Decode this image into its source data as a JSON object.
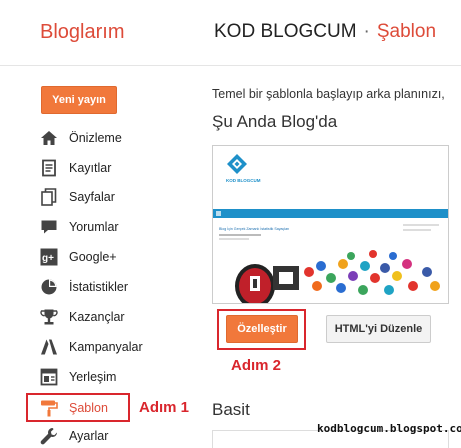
{
  "header": {
    "brand": "Bloglarım",
    "blog_name": "KOD BLOGCUM",
    "separator": "·",
    "page_name": "Şablon"
  },
  "sidebar": {
    "new_post_label": "Yeni yayın",
    "items": [
      {
        "label": "Önizleme",
        "icon": "home-icon"
      },
      {
        "label": "Kayıtlar",
        "icon": "posts-icon"
      },
      {
        "label": "Sayfalar",
        "icon": "pages-icon"
      },
      {
        "label": "Yorumlar",
        "icon": "comments-icon"
      },
      {
        "label": "Google+",
        "icon": "google-plus-icon"
      },
      {
        "label": "İstatistikler",
        "icon": "stats-icon"
      },
      {
        "label": "Kazançlar",
        "icon": "earnings-icon"
      },
      {
        "label": "Kampanyalar",
        "icon": "campaigns-icon"
      },
      {
        "label": "Yerleşim",
        "icon": "layout-icon"
      },
      {
        "label": "Şablon",
        "icon": "template-icon",
        "active": true
      },
      {
        "label": "Ayarlar",
        "icon": "settings-icon"
      }
    ]
  },
  "annotations": {
    "step1": "Adım 1",
    "step2": "Adım 2",
    "highlight_color": "#d9262d"
  },
  "main": {
    "description": "Temel bir şablonla başlayıp arka planınızı,",
    "current_title": "Şu Anda Blog'da",
    "preview": {
      "logo_text": "KOD BLOGCUM",
      "post_title": "Blog İçin Gerçek Zamanlı İstatistik Sayaçları"
    },
    "customize_label": "Özelleştir",
    "edit_html_label": "HTML'yi Düzenle",
    "basic_title": "Basit"
  },
  "watermark": "kodblogcum.blogspot.com",
  "colors": {
    "brand": "#dd4b39",
    "accent_button": "#f1783b"
  }
}
